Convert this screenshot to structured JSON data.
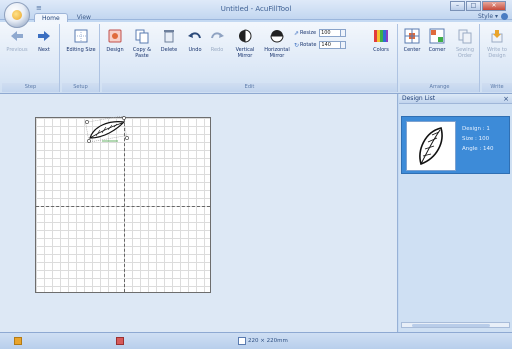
{
  "window": {
    "title": "Untitled - AcuFillTool",
    "qat_symbol": "≡",
    "minimize": "–",
    "maximize": "□",
    "close": "✕"
  },
  "tabs": [
    {
      "label": "Home",
      "active": true
    },
    {
      "label": "View",
      "active": false
    }
  ],
  "style_menu": "Style ▾",
  "ribbon": {
    "groups": [
      {
        "label": "Step"
      },
      {
        "label": "Setup"
      },
      {
        "label": "Edit"
      },
      {
        "label": "Arrange"
      },
      {
        "label": "Write"
      }
    ],
    "buttons": {
      "previous": "Previous",
      "next": "Next",
      "editing_size": "Editing Size",
      "design": "Design",
      "copy_paste": "Copy & Paste",
      "delete": "Delete",
      "undo": "Undo",
      "redo": "Redo",
      "vertical_mirror": "Vertical Mirror",
      "horizontal_mirror": "Horizontal Mirror",
      "colors": "Colors",
      "center": "Center",
      "corner": "Corner",
      "sewing_order": "Sewing Order",
      "write_to_design": "Write to Design"
    },
    "resize": {
      "label": "Resize",
      "value": "100"
    },
    "rotate": {
      "label": "Rotate",
      "value": "140"
    }
  },
  "panel": {
    "title": "Design List",
    "close": "×",
    "item": {
      "design": "Design : 1",
      "size": "Size : 100",
      "angle": "Angle : 140"
    }
  },
  "statusbar": {
    "hoop_size": "220 × 220mm"
  },
  "colors": {
    "accent": "#3d8bd8",
    "ribbon": "#dbe7f6",
    "workspace": "#dde8f5"
  }
}
